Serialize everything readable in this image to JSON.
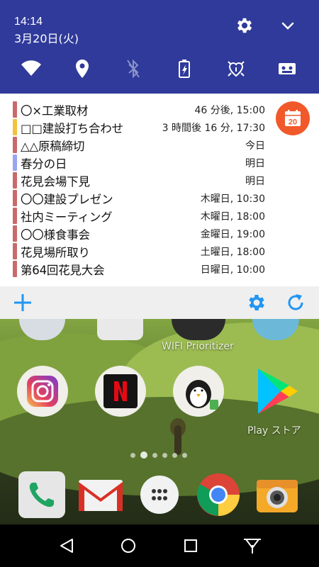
{
  "status": {
    "time": "14:14",
    "date": "3月20日(火)"
  },
  "quick_settings": [
    {
      "icon": "wifi-icon",
      "state": "on"
    },
    {
      "icon": "location-icon",
      "state": "on"
    },
    {
      "icon": "bluetooth-icon",
      "state": "off"
    },
    {
      "icon": "battery-saver-icon",
      "state": "on"
    },
    {
      "icon": "hotspot-icon",
      "state": "on"
    },
    {
      "icon": "cast-icon",
      "state": "on"
    }
  ],
  "calendar": {
    "app_icon_day": "20",
    "events": [
      {
        "title": "〇×工業取材",
        "time": "46 分後, 15:00",
        "color": "#c96a6a"
      },
      {
        "title": "□□建設打ち合わせ",
        "time": "3 時間後 16 分, 17:30",
        "color": "#f2c33a"
      },
      {
        "title": "△△原稿締切",
        "time": "今日",
        "color": "#c96a6a"
      },
      {
        "title": "春分の日",
        "time": "明日",
        "color": "#9aa4f0"
      },
      {
        "title": "花見会場下見",
        "time": "明日",
        "color": "#c96a6a"
      },
      {
        "title": "〇〇建設プレゼン",
        "time": "木曜日, 10:30",
        "color": "#c96a6a"
      },
      {
        "title": "社内ミーティング",
        "time": "木曜日, 18:00",
        "color": "#c96a6a"
      },
      {
        "title": "〇〇様食事会",
        "time": "金曜日, 19:00",
        "color": "#c96a6a"
      },
      {
        "title": "花見場所取り",
        "time": "土曜日, 18:00",
        "color": "#c96a6a"
      },
      {
        "title": "第64回花見大会",
        "time": "日曜日, 10:00",
        "color": "#c96a6a"
      }
    ]
  },
  "home": {
    "wifi_app_label": "WIFI Prioritizer",
    "play_store_label": "Play ストア"
  },
  "colors": {
    "shade_header": "#2f3a9a",
    "accent_blue": "#2196f3",
    "calendar_orange": "#f1592a"
  }
}
